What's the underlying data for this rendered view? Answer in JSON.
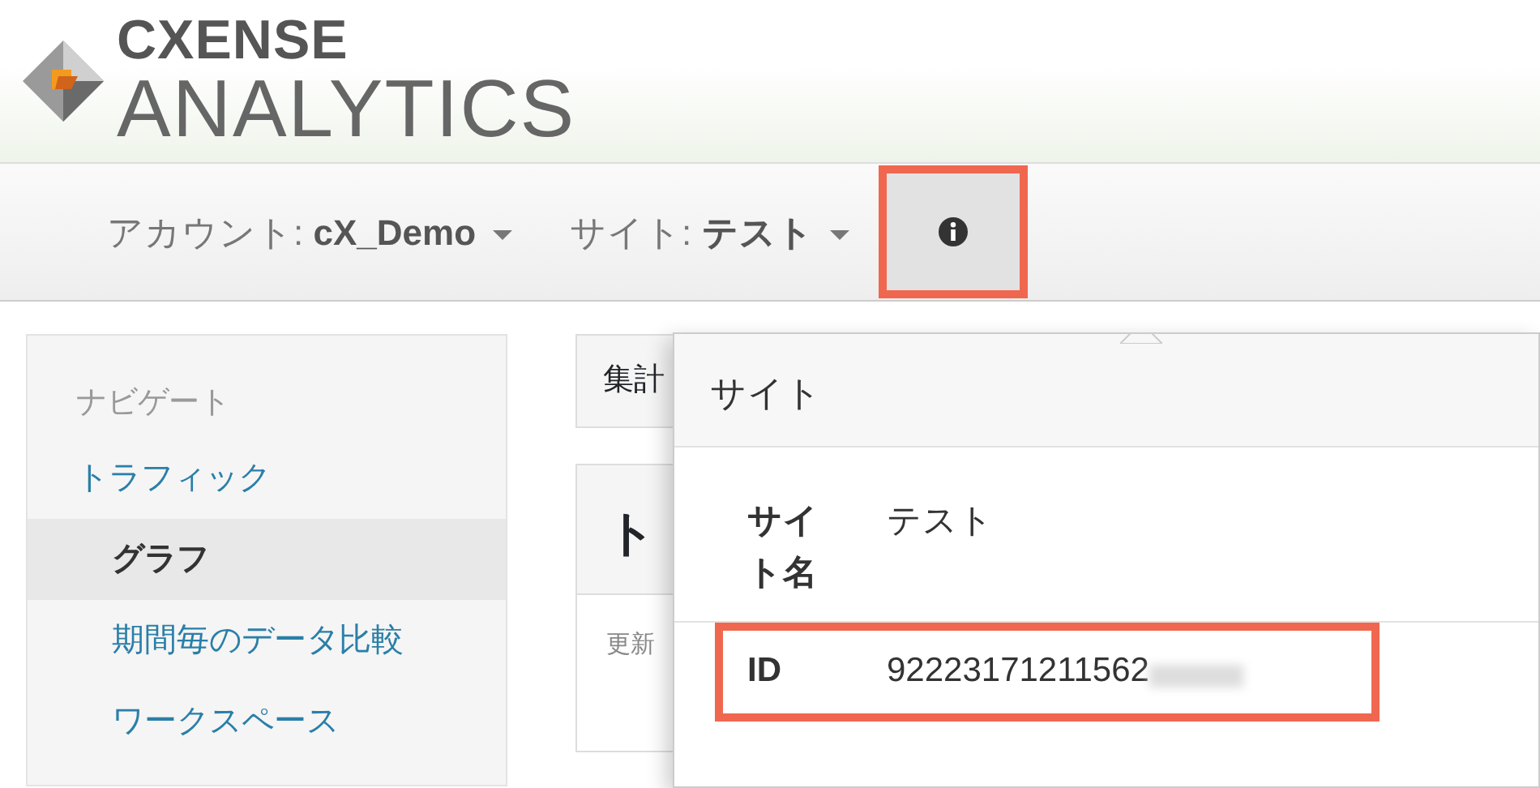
{
  "logo": {
    "line_1": "CXENSE",
    "line_2": "ANALYTICS"
  },
  "navbar": {
    "items": [
      {
        "kind": "dropdown",
        "label": "アカウント:",
        "value": "cX_Demo"
      },
      {
        "kind": "dropdown",
        "label": "サイト:",
        "value": "テスト"
      },
      {
        "kind": "info",
        "highlighted": true,
        "selected": true
      }
    ]
  },
  "sidebar": {
    "heading": "ナビゲート",
    "items": [
      {
        "label": "トラフィック",
        "selected": false,
        "children": [
          {
            "label": "グラフ",
            "selected": true
          },
          {
            "label": "期間毎のデータ比較",
            "selected": false
          },
          {
            "label": "ワークスペース",
            "selected": false
          }
        ]
      }
    ]
  },
  "main": {
    "toolbar_text": "集計",
    "panel_title": "ト",
    "panel_text": "更新"
  },
  "popover": {
    "title": "サイト",
    "rows": [
      {
        "label": "サイト名",
        "value": "テスト",
        "highlighted": false
      },
      {
        "label": "ID",
        "value": "92223171211562",
        "highlighted": true
      }
    ]
  }
}
